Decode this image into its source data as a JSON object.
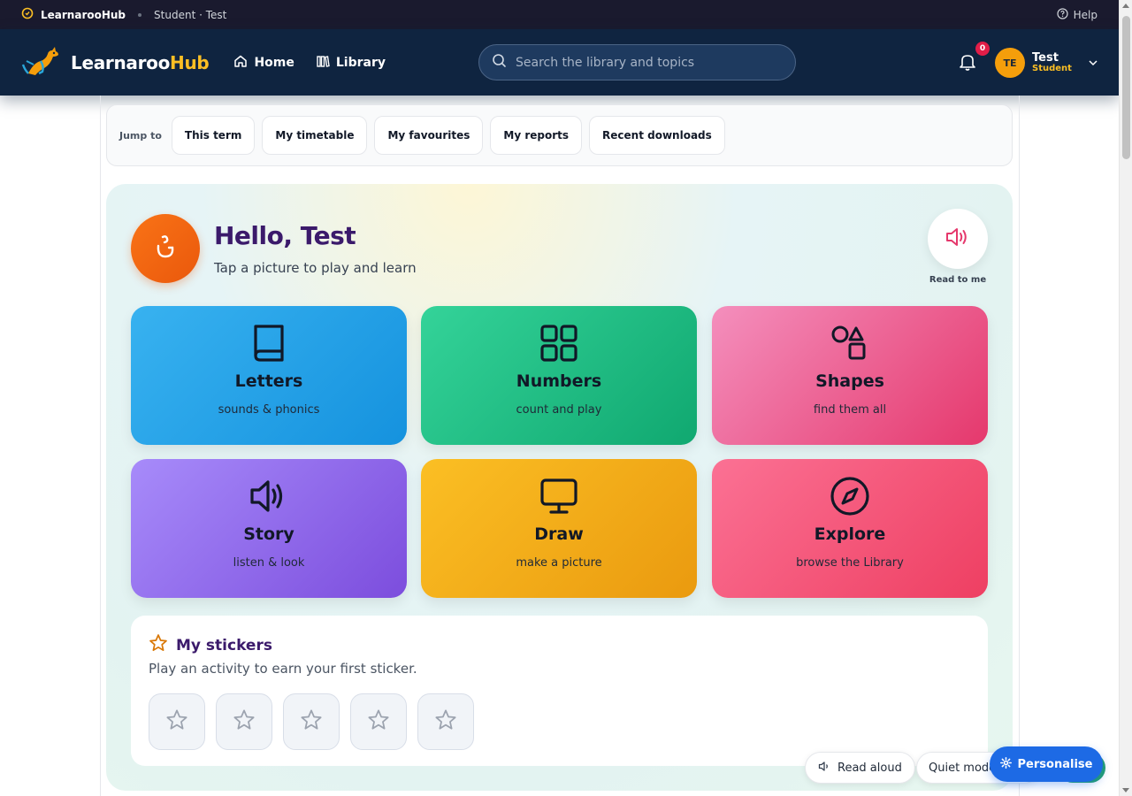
{
  "topbar": {
    "brand": "LearnarooHub",
    "crumb": "Student · Test",
    "help": "Help"
  },
  "nav": {
    "logo_main": "Learnaroo",
    "logo_accent": "Hub",
    "links": [
      {
        "label": "Home",
        "icon": "home-icon"
      },
      {
        "label": "Library",
        "icon": "library-icon"
      }
    ],
    "search_placeholder": "Search the library and topics",
    "notifications_count": "0",
    "user": {
      "initials": "TE",
      "name": "Test",
      "role": "Student"
    }
  },
  "jump": {
    "label": "Jump to",
    "chips": [
      "This term",
      "My timetable",
      "My favourites",
      "My reports",
      "Recent downloads"
    ]
  },
  "hero": {
    "greeting": "Hello, Test",
    "subtitle": "Tap a picture to play and learn",
    "read_label": "Read to me"
  },
  "tiles": [
    {
      "title": "Letters",
      "sub": "sounds & phonics",
      "icon": "book-icon"
    },
    {
      "title": "Numbers",
      "sub": "count and play",
      "icon": "grid-icon"
    },
    {
      "title": "Shapes",
      "sub": "find them all",
      "icon": "shapes-icon"
    },
    {
      "title": "Story",
      "sub": "listen & look",
      "icon": "speaker-icon"
    },
    {
      "title": "Draw",
      "sub": "make a picture",
      "icon": "monitor-icon"
    },
    {
      "title": "Explore",
      "sub": "browse the Library",
      "icon": "compass-icon"
    }
  ],
  "stickers": {
    "title": "My stickers",
    "subtitle": "Play an activity to earn your first sticker.",
    "slots": 5
  },
  "floating": {
    "read_aloud": "Read aloud",
    "quiet_mode": "Quiet mode",
    "personalise": "Personalise"
  },
  "colors": {
    "nav_bg": "#0f2440",
    "accent": "#fbbf24",
    "greeting": "#3b1a6b",
    "personalise": "#1d6ae5"
  }
}
